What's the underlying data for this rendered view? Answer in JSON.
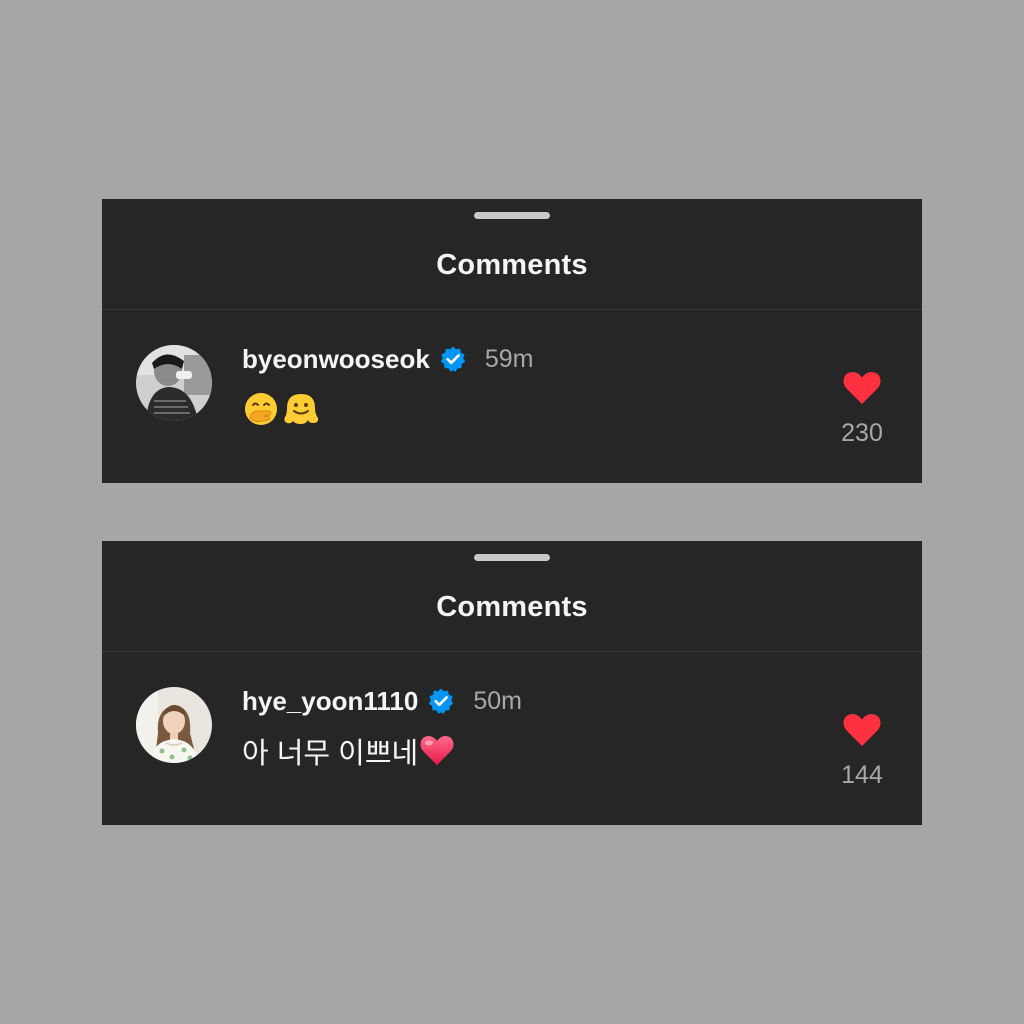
{
  "colors": {
    "page_background": "#a6a6a6",
    "panel_background": "#262626",
    "verified_blue": "#0095f6",
    "like_red": "#ff3040",
    "muted_text": "#a8a8a8"
  },
  "panels": [
    {
      "title": "Comments",
      "comment": {
        "username": "byeonwooseok",
        "verified": true,
        "timestamp": "59m",
        "text": "",
        "emojis": [
          "face-with-hand-over-mouth-emoji",
          "melting-face-emoji"
        ],
        "like_icon": "heart-icon",
        "likes": "230"
      }
    },
    {
      "title": "Comments",
      "comment": {
        "username": "hye_yoon1110",
        "verified": true,
        "timestamp": "50m",
        "text": "아 너무 이쁘네",
        "emojis": [
          "red-heart-emoji"
        ],
        "like_icon": "heart-icon",
        "likes": "144"
      }
    }
  ]
}
